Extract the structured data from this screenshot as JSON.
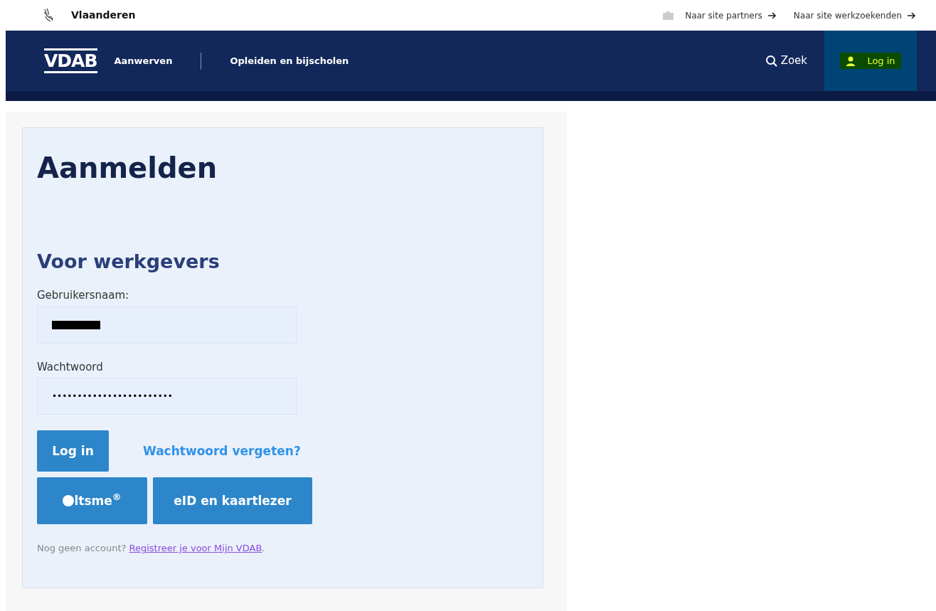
{
  "top_bar": {
    "brand": "Vlaanderen",
    "links": [
      {
        "label": "Naar site partners"
      },
      {
        "label": "Naar site werkzoekenden"
      }
    ]
  },
  "navbar": {
    "logo": "VDAB",
    "items": [
      {
        "label": "Aanwerven"
      },
      {
        "label": "Opleiden en bijscholen"
      }
    ],
    "search": "Zoek",
    "login": "Log in"
  },
  "login_card": {
    "title": "Aanmelden",
    "subtitle": "Voor werkgevers",
    "fields": [
      {
        "label": "Gebruikersnaam:",
        "redacted": true
      },
      {
        "label": "Wachtwoord",
        "value": "••••••••••••••••••••••••",
        "redacted": false
      }
    ],
    "submit": "Log in",
    "forgot_link": "Wachtwoord vergeten?",
    "alt_buttons": [
      {
        "kind": "itsme",
        "label": "ltsme$^{®}$"
      },
      {
        "kind": "text",
        "label": "eID en kaartlezer"
      }
    ],
    "register_text": "Nog geen account?",
    "register_link": "Registreer je voor Mijn VDAB",
    "register_end": "."
  }
}
